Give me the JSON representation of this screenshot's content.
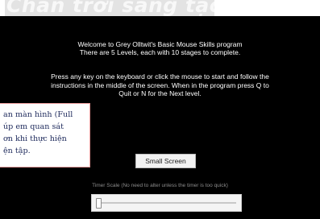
{
  "watermark": {
    "text": "Chân trời sáng tạo"
  },
  "program": {
    "welcome_lines": [
      "Welcome to Grey Olltwit's Basic Mouse Skills program",
      "There are 5 Levels, each with 10 stages to complete."
    ],
    "instruction_lines": [
      "Press any key on the keyboard or click the mouse to start and follow the",
      "instructions in the middle of the screen. When in the program press Q to",
      "Quit or N for the Next level."
    ],
    "fullscreen_button": "Small Screen",
    "timer_label": "Timer Scale (No need to alter unless the timer is too quick)",
    "timer_scale_value": 0
  },
  "callout": {
    "lines": [
      "an màn hình (Full",
      "úp em quan sát",
      "ơn khi thực hiện",
      "ện tập."
    ]
  },
  "colors": {
    "screen_background": "#000000",
    "program_text": "#ffffff",
    "timer_label_text": "#8c8c8c",
    "callout_text": "#1e2a5c",
    "callout_border": "#f0a0a0"
  }
}
